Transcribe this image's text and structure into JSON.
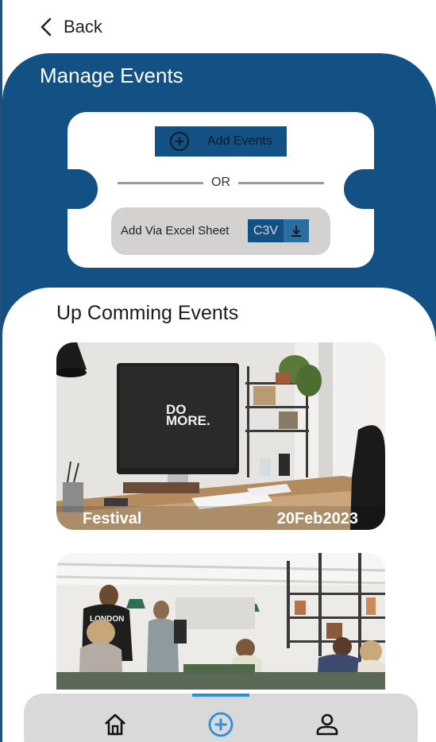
{
  "header": {
    "back_label": "Back"
  },
  "manage": {
    "title": "Manage Events",
    "add_events_label": "Add Events",
    "or_label": "OR",
    "excel_label": "Add Via Excel Sheet",
    "csv_label": "C3V"
  },
  "upcoming": {
    "title": "Up Comming Events",
    "events": [
      {
        "name": "Festival",
        "date": "20Feb2023",
        "image_text": "DO MORE."
      },
      {
        "name": "",
        "date": "",
        "image_text": "LONDON"
      }
    ]
  },
  "nav": {
    "items": [
      {
        "icon": "home-icon"
      },
      {
        "icon": "add-circle-icon",
        "active": true
      },
      {
        "icon": "person-icon"
      }
    ]
  },
  "colors": {
    "primary": "#135185",
    "accent": "#2b8fe0",
    "pill": "#d4d1d1",
    "nav": "#d9d9d9"
  }
}
